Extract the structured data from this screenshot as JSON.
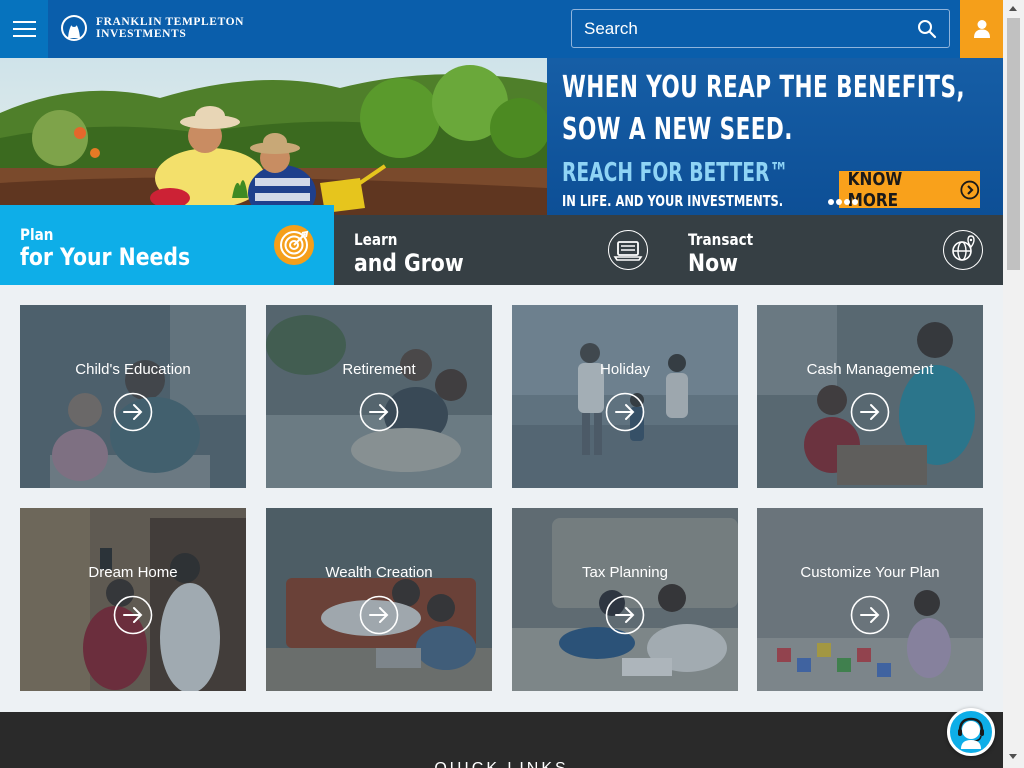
{
  "header": {
    "menu_icon": "hamburger-menu-icon",
    "logo": {
      "line1": "FRANKLIN TEMPLETON",
      "line2": "INVESTMENTS"
    },
    "search": {
      "placeholder": "Search",
      "icon": "search-icon"
    },
    "user_icon": "user-icon"
  },
  "banner": {
    "headline1": "WHEN YOU REAP THE BENEFITS,",
    "headline2": "SOW A NEW SEED.",
    "reach": "REACH FOR BETTER™",
    "sub": "IN LIFE. AND YOUR INVESTMENTS.",
    "cta": "KNOW MORE",
    "slide_count": 4
  },
  "tabs": [
    {
      "line1": "Plan",
      "line2": "for Your Needs",
      "icon": "target-icon"
    },
    {
      "line1": "Learn",
      "line2": "and Grow",
      "icon": "laptop-icon"
    },
    {
      "line1": "Transact",
      "line2": "Now",
      "icon": "globe-icon"
    }
  ],
  "goals": [
    {
      "label": "Child's Education"
    },
    {
      "label": "Retirement"
    },
    {
      "label": "Holiday"
    },
    {
      "label": "Cash Management"
    },
    {
      "label": "Dream Home"
    },
    {
      "label": "Wealth Creation"
    },
    {
      "label": "Tax Planning"
    },
    {
      "label": "Customize Your Plan"
    }
  ],
  "footer": {
    "quick_links": "QUICK LINKS"
  },
  "chat_icon": "support-agent-icon",
  "colors": {
    "header_blue": "#0a5eab",
    "accent_orange": "#f59f1a",
    "plan_cyan": "#0eaee8",
    "tab_dark": "#363f44"
  }
}
